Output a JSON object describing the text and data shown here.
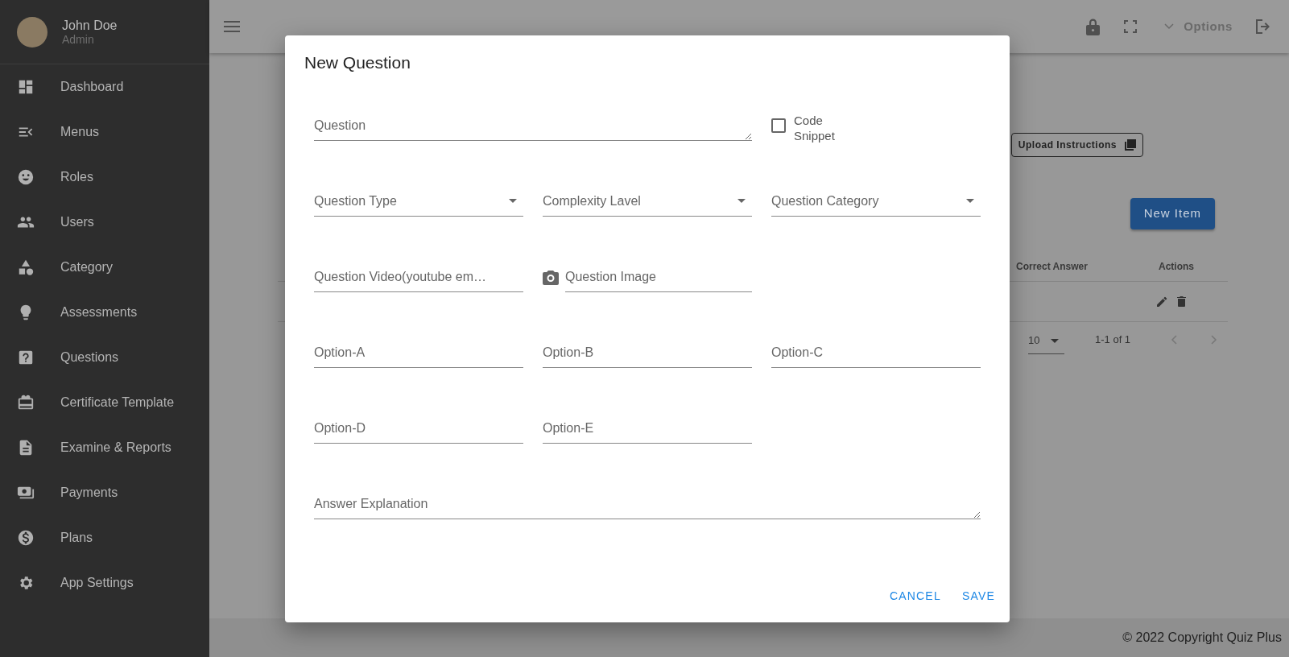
{
  "sidebar": {
    "user": {
      "name": "John Doe",
      "role": "Admin"
    },
    "items": [
      {
        "label": "Dashboard"
      },
      {
        "label": "Menus"
      },
      {
        "label": "Roles"
      },
      {
        "label": "Users"
      },
      {
        "label": "Category"
      },
      {
        "label": "Assessments"
      },
      {
        "label": "Questions"
      },
      {
        "label": "Certificate Template"
      },
      {
        "label": "Examine & Reports"
      },
      {
        "label": "Payments"
      },
      {
        "label": "Plans"
      },
      {
        "label": "App Settings"
      }
    ]
  },
  "header": {
    "options_label": "Options"
  },
  "page": {
    "upload_button": "Upload Instructions",
    "new_button": "New Item",
    "table": {
      "columns": [
        "Correct Answer",
        "Actions"
      ]
    },
    "pagination": {
      "rows_per_page": "10",
      "range": "1-1 of 1"
    }
  },
  "dialog": {
    "title": "New Question",
    "rows": [
      [
        {
          "kind": "textarea",
          "placeholder": "Question"
        },
        "",
        {
          "kind": "checkbox",
          "label": "Code Snippet",
          "checked": false
        }
      ],
      [
        {
          "kind": "select",
          "label": "Question Type"
        },
        {
          "kind": "select",
          "label": "Complexity Lavel"
        },
        {
          "kind": "select",
          "label": "Question Category"
        }
      ],
      [
        {
          "kind": "text",
          "placeholder": "Question Video(youtube em…"
        },
        {
          "kind": "image",
          "placeholder": "Question Image"
        }
      ],
      [
        {
          "kind": "text",
          "placeholder": "Option-A"
        },
        {
          "kind": "text",
          "placeholder": "Option-B"
        },
        {
          "kind": "text",
          "placeholder": "Option-C"
        }
      ],
      [
        {
          "kind": "text",
          "placeholder": "Option-D"
        },
        {
          "kind": "text",
          "placeholder": "Option-E"
        }
      ],
      [
        {
          "kind": "textarea",
          "placeholder": "Answer Explanation"
        },
        "",
        ""
      ]
    ],
    "buttons": [
      "CANCEL",
      "SAVE"
    ]
  },
  "footer": "© 2022 Copyright Quiz Plus"
}
